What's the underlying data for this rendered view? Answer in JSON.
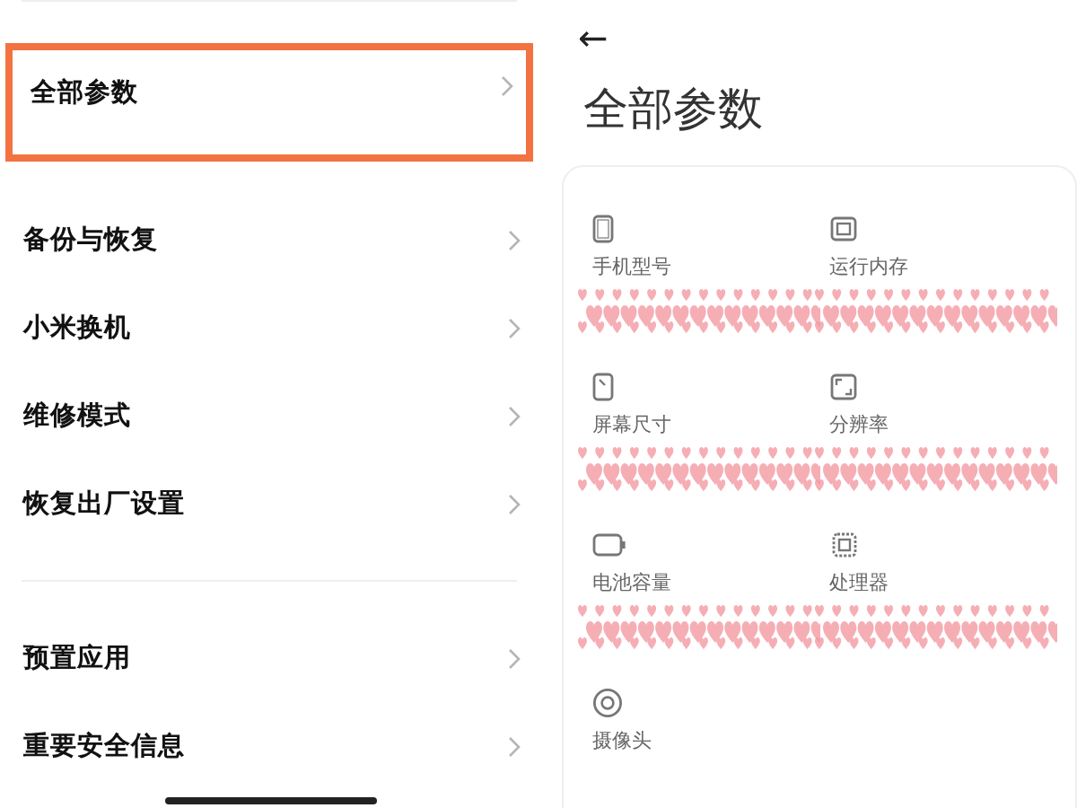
{
  "settings_list": {
    "groups": [
      {
        "items": [
          {
            "label": "全部参数",
            "highlighted": true
          }
        ]
      },
      {
        "items": [
          {
            "label": "备份与恢复",
            "highlighted": false
          },
          {
            "label": "小米换机",
            "highlighted": false
          },
          {
            "label": "维修模式",
            "highlighted": false
          },
          {
            "label": "恢复出厂设置",
            "highlighted": false
          }
        ]
      },
      {
        "items": [
          {
            "label": "预置应用",
            "highlighted": false
          },
          {
            "label": "重要安全信息",
            "highlighted": false
          }
        ]
      }
    ]
  },
  "detail": {
    "back": "←",
    "title": "全部参数",
    "specs": [
      {
        "kind": "phone",
        "label": "手机型号",
        "redacted": true
      },
      {
        "kind": "memory",
        "label": "运行内存",
        "redacted": true
      },
      {
        "kind": "screen",
        "label": "屏幕尺寸",
        "redacted": true
      },
      {
        "kind": "resolution",
        "label": "分辨率",
        "redacted": true
      },
      {
        "kind": "battery",
        "label": "电池容量",
        "redacted": true
      },
      {
        "kind": "processor",
        "label": "处理器",
        "redacted": true
      },
      {
        "kind": "camera",
        "label": "摄像头"
      }
    ]
  }
}
